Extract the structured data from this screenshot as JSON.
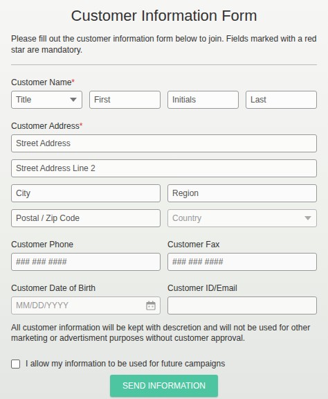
{
  "title": "Customer Information Form",
  "intro": "Please fill out the customer information form below to join. Fields marked with a red star are mandatory.",
  "required_mark": "*",
  "groups": [
    {
      "kind": "stacked",
      "label": "Customer Name",
      "required": true,
      "rows": [
        [
          {
            "kind": "select",
            "placeholder": "Title",
            "muted": false
          },
          {
            "kind": "text",
            "placeholder": "First",
            "muted": false
          },
          {
            "kind": "text",
            "placeholder": "Initials",
            "muted": false
          },
          {
            "kind": "text",
            "placeholder": "Last",
            "muted": false
          }
        ]
      ]
    },
    {
      "kind": "stacked",
      "label": "Customer Address",
      "required": true,
      "rows": [
        [
          {
            "kind": "text",
            "placeholder": "Street Address",
            "muted": false
          }
        ],
        [
          {
            "kind": "text",
            "placeholder": "Street Address Line 2",
            "muted": false
          }
        ],
        [
          {
            "kind": "text",
            "placeholder": "City",
            "muted": false
          },
          {
            "kind": "text",
            "placeholder": "Region",
            "muted": false
          }
        ],
        [
          {
            "kind": "text",
            "placeholder": "Postal / Zip Code",
            "muted": false
          },
          {
            "kind": "select",
            "placeholder": "Country",
            "muted": true
          }
        ]
      ]
    },
    {
      "kind": "split",
      "items": [
        {
          "label": "Customer Phone",
          "required": false,
          "field": {
            "kind": "text",
            "placeholder": "### ### ####",
            "muted": false
          }
        },
        {
          "label": "Customer Fax",
          "required": false,
          "field": {
            "kind": "text",
            "placeholder": "### ### ####",
            "muted": false
          }
        }
      ]
    },
    {
      "kind": "split",
      "items": [
        {
          "label": "Customer Date of Birth",
          "required": false,
          "field": {
            "kind": "date",
            "placeholder": "MM/DD/YYYY",
            "muted": true
          }
        },
        {
          "label": "Customer ID/Email",
          "required": false,
          "field": {
            "kind": "text",
            "placeholder": "",
            "muted": false
          }
        }
      ]
    }
  ],
  "notice": "All customer information will be kept with descretion and will not be used for other marketing or advertisment purposes without customer approval.",
  "consent": {
    "label": "I allow my information to be used for future campaigns",
    "checked": false
  },
  "button": "SEND INFORMATION"
}
